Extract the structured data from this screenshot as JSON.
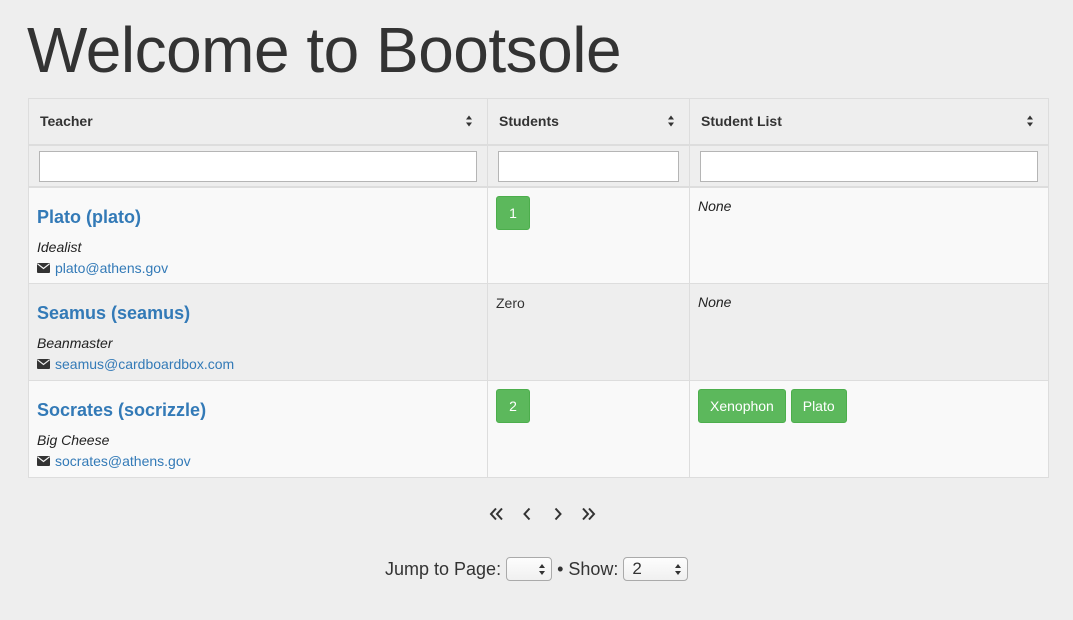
{
  "page": {
    "title": "Welcome to Bootsole"
  },
  "table": {
    "columns": [
      {
        "label": "Teacher"
      },
      {
        "label": "Students"
      },
      {
        "label": "Student List"
      }
    ],
    "filters": [
      "",
      "",
      ""
    ],
    "rows": [
      {
        "name": "Plato (plato)",
        "role": "Idealist",
        "email": "plato@athens.gov",
        "student_count": "1",
        "student_count_is_button": true,
        "student_list": [],
        "none_label": "None"
      },
      {
        "name": "Seamus (seamus)",
        "role": "Beanmaster",
        "email": "seamus@cardboardbox.com",
        "student_count": "Zero",
        "student_count_is_button": false,
        "student_list": [],
        "none_label": "None"
      },
      {
        "name": "Socrates (socrizzle)",
        "role": "Big Cheese",
        "email": "socrates@athens.gov",
        "student_count": "2",
        "student_count_is_button": true,
        "student_list": [
          "Xenophon",
          "Plato"
        ],
        "none_label": ""
      }
    ]
  },
  "pagination": {
    "icons": [
      "double-chevron-left-icon",
      "chevron-left-icon",
      "chevron-right-icon",
      "double-chevron-right-icon"
    ],
    "jump_label": "Jump to Page:",
    "jump_value": "",
    "separator": "•",
    "show_label": "Show:",
    "show_value": "2"
  },
  "colors": {
    "link": "#337ab7",
    "success": "#5cb85c",
    "background": "#eeeeee"
  }
}
